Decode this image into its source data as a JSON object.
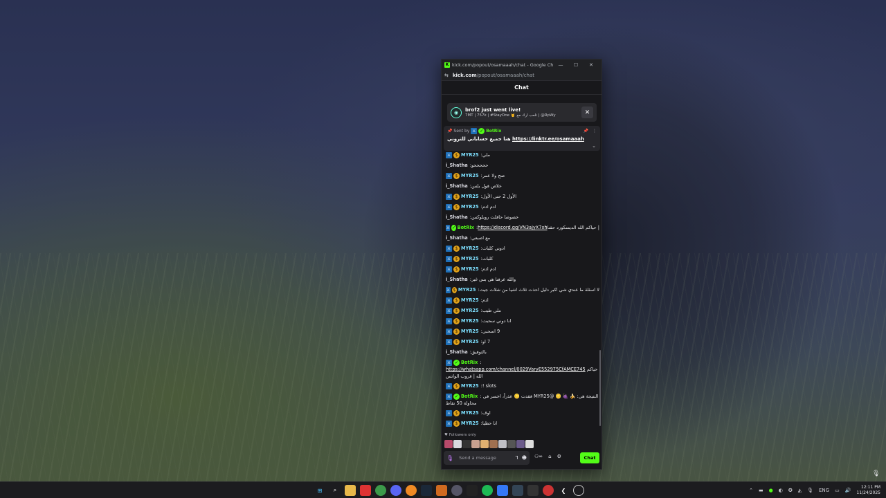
{
  "window": {
    "title": "kick.com/popout/osamaaah/chat - Google Chrome",
    "url_host": "kick.com",
    "url_path": "/popout/osamaaah/chat"
  },
  "chat": {
    "header": "Chat",
    "notification": {
      "title": "brof2 just went live!",
      "subtitle": "7MT | 757k | #StayOne 🤘 تلعب آرك مع | @RpWy"
    },
    "pinned": {
      "sent_by_label": "Sent by",
      "sender": "BotRix",
      "text": "هنا جميع حساباتي للتروني",
      "link": "https://linktr.ee/osamaaah"
    },
    "messages": [
      {
        "user": "MYR25",
        "badges": [
          "mod",
          "sub"
        ],
        "text": "ملي",
        "type": "myr"
      },
      {
        "user": "i_Shatha",
        "badges": [],
        "text": "حححححو",
        "type": "shatha"
      },
      {
        "user": "MYR25",
        "badges": [
          "mod",
          "sub"
        ],
        "text": "صح ولا عمر",
        "type": "myr"
      },
      {
        "user": "i_Shatha",
        "badges": [],
        "text": "خلاص فول بلس",
        "type": "shatha"
      },
      {
        "user": "MYR25",
        "badges": [
          "mod",
          "sub"
        ],
        "text": "الأول 2 حتى الأول",
        "type": "myr"
      },
      {
        "user": "MYR25",
        "badges": [
          "mod",
          "sub"
        ],
        "text": "ادم ادم",
        "type": "myr"
      },
      {
        "user": "i_Shatha",
        "badges": [],
        "text": "خصوصا حاقلت روبلوكس",
        "type": "shatha"
      },
      {
        "user": "BotRix",
        "badges": [
          "mod",
          "ver"
        ],
        "text": "| حياكم الله الديسكورد حقنا",
        "link": "https://discord.gg/VN3ajyX7xh",
        "type": "bot"
      },
      {
        "user": "i_Shatha",
        "badges": [],
        "text": "مع اصبعي",
        "type": "shatha"
      },
      {
        "user": "MYR25",
        "badges": [
          "mod",
          "sub"
        ],
        "text": "ادوني كلبات",
        "type": "myr"
      },
      {
        "user": "MYR25",
        "badges": [
          "mod",
          "sub"
        ],
        "text": "كلبات",
        "type": "myr"
      },
      {
        "user": "MYR25",
        "badges": [
          "mod",
          "sub"
        ],
        "text": "ادم ادم",
        "type": "myr"
      },
      {
        "user": "i_Shatha",
        "badges": [],
        "text": "والله عرفنا هي بس غير",
        "type": "shatha"
      },
      {
        "user": "MYR25",
        "badges": [
          "mod",
          "sub"
        ],
        "text": "لا اسئلة ما عندي شي اكبر دليل احذت ثلاث اشيا من شلات جيت",
        "type": "myr"
      },
      {
        "user": "MYR25",
        "badges": [
          "mod",
          "sub"
        ],
        "text": "ادم",
        "type": "myr"
      },
      {
        "user": "MYR25",
        "badges": [
          "mod",
          "sub"
        ],
        "text": "ملي طيب",
        "type": "myr"
      },
      {
        "user": "MYR25",
        "badges": [
          "mod",
          "sub"
        ],
        "text": "انا دوني سحبت",
        "type": "myr"
      },
      {
        "user": "MYR25",
        "badges": [
          "mod",
          "sub"
        ],
        "text": "9 اسحبي",
        "type": "myr"
      },
      {
        "user": "MYR25",
        "badges": [
          "mod",
          "sub"
        ],
        "text": "7 او",
        "type": "myr"
      },
      {
        "user": "i_Shatha",
        "badges": [],
        "text": "بالتوفيق",
        "type": "shatha"
      },
      {
        "user": "BotRix",
        "badges": [
          "mod",
          "ver"
        ],
        "text": "حياكم الله | قروب الواتس",
        "link": "https://whatsapp.com/channel/0029VaryE552975CfAMCE745",
        "type": "bot-wrap"
      },
      {
        "user": "MYR25",
        "badges": [
          "mod",
          "sub"
        ],
        "text": "! slots",
        "type": "myr"
      },
      {
        "user": "BotRix",
        "badges": [
          "mod",
          "ver"
        ],
        "text": "النتيجة هي: 🍌 🍇 🪙 @MYR25 فقدت 🪙 عذراً، اخسر في محاولة 50 نقاط",
        "type": "bot-wrap"
      },
      {
        "user": "MYR25",
        "badges": [
          "mod",
          "sub"
        ],
        "text": "اوف",
        "type": "myr"
      },
      {
        "user": "MYR25",
        "badges": [
          "mod",
          "sub"
        ],
        "text": "انا حظيا",
        "type": "myr"
      }
    ],
    "followers_only": "Followers only",
    "input_placeholder": "Send a message",
    "send_label": "Chat"
  },
  "taskbar": {
    "lang": "ENG",
    "time": "12:11 PM",
    "date": "11/24/2025"
  },
  "colors": {
    "kick_green": "#53fc18",
    "chat_bg": "#18181b",
    "mod_blue": "#1e6fb8",
    "sub_gold": "#e0a21a"
  }
}
